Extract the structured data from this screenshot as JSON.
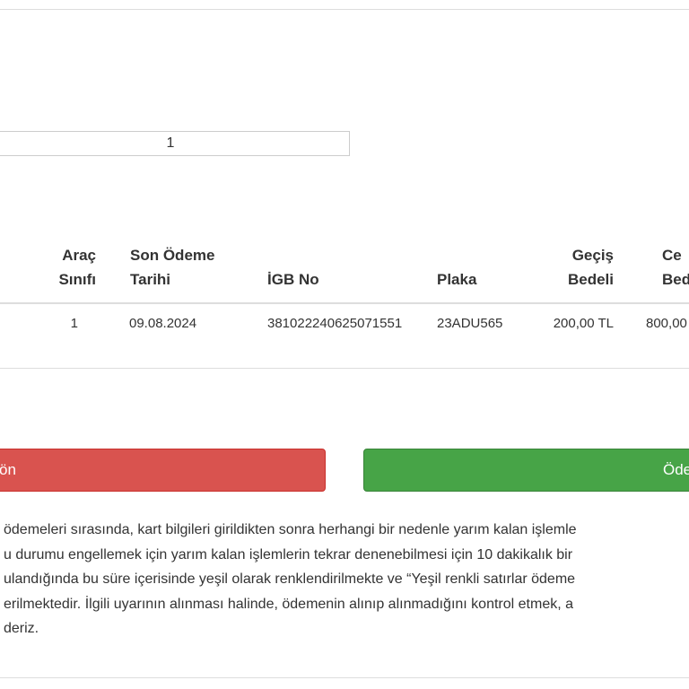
{
  "quantity_field": {
    "value": "1"
  },
  "table": {
    "headers": {
      "vehicle_class": [
        "Araç",
        "Sınıfı"
      ],
      "due_date": [
        "Son Ödeme",
        "Tarihi"
      ],
      "igb_no": "İGB No",
      "plate": "Plaka",
      "toll_fee": [
        "Geçiş",
        "Bedeli"
      ],
      "penalty_fee": [
        "Ce",
        "Bed"
      ]
    },
    "rows": [
      {
        "vehicle_class": "1",
        "due_date": "09.08.2024",
        "igb_no": "381022240625071551",
        "plate": "23ADU565",
        "toll_fee": "200,00 TL",
        "penalty_fee": "800,00"
      }
    ]
  },
  "buttons": {
    "back_label": "ön",
    "pay_label": "Öde"
  },
  "notice_lines": [
    "ödemeleri sırasında, kart bilgileri girildikten sonra herhangi bir nedenle yarım kalan işlemle",
    "u durumu engellemek için yarım kalan işlemlerin tekrar denenebilmesi için 10 dakikalık bir",
    "ulandığında bu süre içerisinde yeşil olarak renklendirilmekte ve “Yeşil renkli satırlar ödeme",
    "erilmektedir. İlgili uyarının alınması halinde, ödemenin alınıp alınmadığını kontrol etmek, a",
    "deriz."
  ],
  "colors": {
    "back_button": "#d9534f",
    "pay_button": "#47a447",
    "border": "#dddddd"
  }
}
